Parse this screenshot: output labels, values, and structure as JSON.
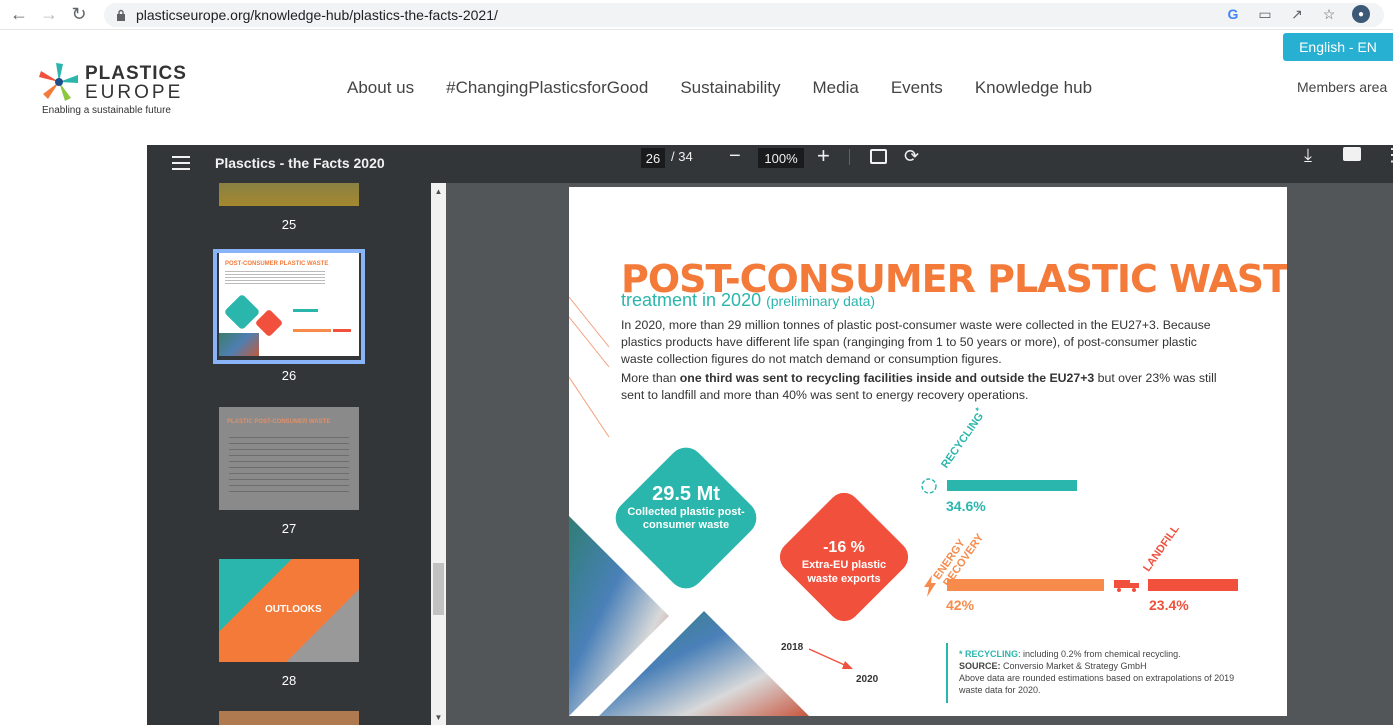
{
  "browser": {
    "url": "plasticseurope.org/knowledge-hub/plastics-the-facts-2021/"
  },
  "site": {
    "logo_line1": "PLASTICS",
    "logo_line2": "EUROPE",
    "logo_tagline": "Enabling a sustainable future",
    "nav": [
      "About us",
      "#ChangingPlasticsforGood",
      "Sustainability",
      "Media",
      "Events",
      "Knowledge hub"
    ],
    "language": "English - EN",
    "members": "Members area"
  },
  "pdf": {
    "title": "Plasctics - the Facts 2020",
    "current_page": "26",
    "total_pages": "/ 34",
    "zoom": "100%",
    "thumbnails": [
      {
        "label": "25"
      },
      {
        "label": "26",
        "text": "POST-CONSUMER PLASTIC WASTE"
      },
      {
        "label": "27",
        "text": "PLASTIC POST-CONSUMER WASTE"
      },
      {
        "label": "28",
        "text": "OUTLOOKS"
      }
    ],
    "page": {
      "title": "POST-CONSUMER PLASTIC WASTE",
      "subtitle": "treatment in 2020",
      "subtitle_note": "(preliminary data)",
      "para1": "In 2020, more than 29 million tonnes of plastic post-consumer waste were collected in the EU27+3. Because plastics products have different life span (ranginging from 1 to 50 years or more), of post-consumer plastic waste collection figures do not match demand or consumption figures.",
      "para2_pre": "More than ",
      "para2_bold": "one third was sent to recycling facilities inside and outside the EU27+3",
      "para2_post": " but over 23% was still sent to landfill and more than 40% was sent to energy recovery operations.",
      "collected_value": "29.5 Mt",
      "collected_label": "Collected plastic post-consumer waste",
      "exports_value": "-16 %",
      "exports_label": "Extra-EU plastic waste exports",
      "year_from": "2018",
      "year_to": "2020",
      "page_number": "26",
      "recycling_label": "RECYCLING",
      "recycling_star": "*",
      "recycling_value": "34.6%",
      "energy_label1": "ENERGY",
      "energy_label2": "RECOVERY",
      "energy_value": "42%",
      "landfill_label": "LANDFILL",
      "landfill_value": "23.4%",
      "footnote_star": "* RECYCLING",
      "footnote_line1": ": including 0.2% from chemical recycling.",
      "footnote_source_label": "SOURCE:",
      "footnote_source": " Conversio Market & Strategy GmbH",
      "footnote_line3": "Above data are rounded estimations based on extrapolations of 2019 waste data for 2020."
    },
    "colors": {
      "orange": "#f47a3a",
      "teal": "#2bb6ad",
      "red": "#f0503c",
      "energy": "#f68b4b"
    }
  }
}
